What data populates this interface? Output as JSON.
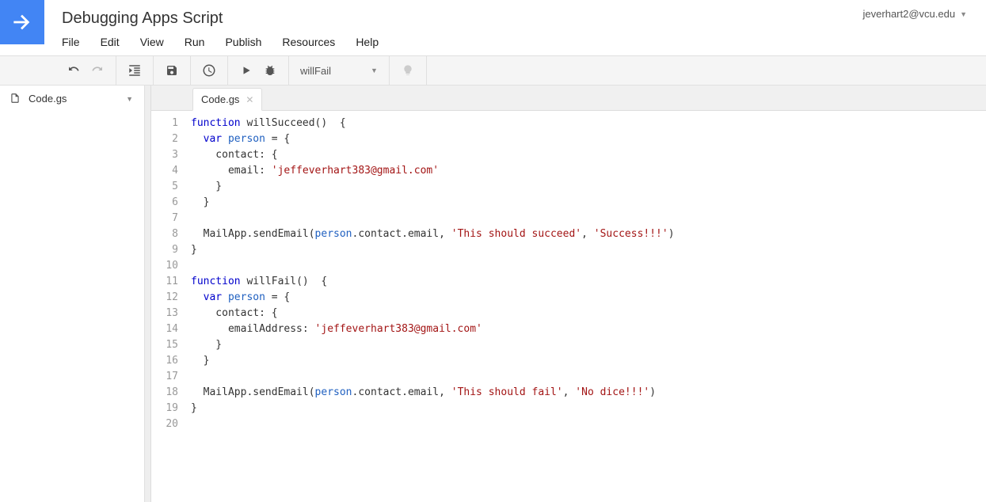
{
  "header": {
    "title": "Debugging Apps Script",
    "user": "jeverhart2@vcu.edu"
  },
  "menu": [
    "File",
    "Edit",
    "View",
    "Run",
    "Publish",
    "Resources",
    "Help"
  ],
  "toolbar": {
    "selected_function": "willFail"
  },
  "sidebar": {
    "file": "Code.gs"
  },
  "tabs": [
    {
      "label": "Code.gs"
    }
  ],
  "code": {
    "line_count": 20,
    "lines": [
      {
        "n": 1,
        "tokens": [
          [
            "kw",
            "function"
          ],
          [
            "plain",
            " willSucceed()  {"
          ]
        ]
      },
      {
        "n": 2,
        "tokens": [
          [
            "plain",
            "  "
          ],
          [
            "kw",
            "var"
          ],
          [
            "plain",
            " "
          ],
          [
            "ident",
            "person"
          ],
          [
            "plain",
            " = {"
          ]
        ]
      },
      {
        "n": 3,
        "tokens": [
          [
            "plain",
            "    contact: {"
          ]
        ]
      },
      {
        "n": 4,
        "tokens": [
          [
            "plain",
            "      email: "
          ],
          [
            "str",
            "'jeffeverhart383@gmail.com'"
          ]
        ]
      },
      {
        "n": 5,
        "tokens": [
          [
            "plain",
            "    }"
          ]
        ]
      },
      {
        "n": 6,
        "tokens": [
          [
            "plain",
            "  }"
          ]
        ]
      },
      {
        "n": 7,
        "tokens": [
          [
            "plain",
            "  "
          ]
        ]
      },
      {
        "n": 8,
        "tokens": [
          [
            "plain",
            "  MailApp.sendEmail("
          ],
          [
            "ident",
            "person"
          ],
          [
            "plain",
            ".contact.email, "
          ],
          [
            "str",
            "'This should succeed'"
          ],
          [
            "plain",
            ", "
          ],
          [
            "str",
            "'Success!!!'"
          ],
          [
            "plain",
            ")"
          ]
        ]
      },
      {
        "n": 9,
        "tokens": [
          [
            "plain",
            "}"
          ]
        ]
      },
      {
        "n": 10,
        "tokens": [
          [
            "plain",
            ""
          ]
        ]
      },
      {
        "n": 11,
        "tokens": [
          [
            "kw",
            "function"
          ],
          [
            "plain",
            " willFail()  {"
          ]
        ]
      },
      {
        "n": 12,
        "tokens": [
          [
            "plain",
            "  "
          ],
          [
            "kw",
            "var"
          ],
          [
            "plain",
            " "
          ],
          [
            "ident",
            "person"
          ],
          [
            "plain",
            " = {"
          ]
        ]
      },
      {
        "n": 13,
        "tokens": [
          [
            "plain",
            "    contact: {"
          ]
        ]
      },
      {
        "n": 14,
        "tokens": [
          [
            "plain",
            "      emailAddress: "
          ],
          [
            "str",
            "'jeffeverhart383@gmail.com'"
          ]
        ]
      },
      {
        "n": 15,
        "tokens": [
          [
            "plain",
            "    }"
          ]
        ]
      },
      {
        "n": 16,
        "tokens": [
          [
            "plain",
            "  }"
          ]
        ]
      },
      {
        "n": 17,
        "tokens": [
          [
            "plain",
            "  "
          ]
        ]
      },
      {
        "n": 18,
        "tokens": [
          [
            "plain",
            "  MailApp.sendEmail("
          ],
          [
            "ident",
            "person"
          ],
          [
            "plain",
            ".contact.email, "
          ],
          [
            "str",
            "'This should fail'"
          ],
          [
            "plain",
            ", "
          ],
          [
            "str",
            "'No dice!!!'"
          ],
          [
            "plain",
            ")"
          ]
        ]
      },
      {
        "n": 19,
        "tokens": [
          [
            "plain",
            "}"
          ]
        ]
      },
      {
        "n": 20,
        "tokens": [
          [
            "plain",
            ""
          ]
        ]
      }
    ]
  }
}
